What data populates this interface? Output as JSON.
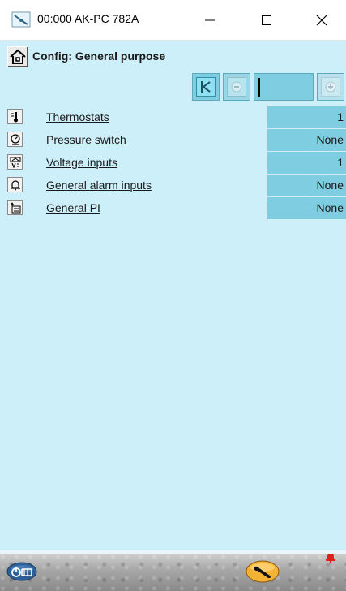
{
  "window": {
    "title": "00:000 AK-PC 782A",
    "icon": "app-plug-icon",
    "controls": [
      "minimize-icon",
      "maximize-icon",
      "close-icon"
    ]
  },
  "header": {
    "home_icon": "home-icon",
    "title": "Config: General purpose"
  },
  "navigation": {
    "buttons": [
      "first-page-icon",
      "previous-page-icon",
      "next-page-icon"
    ],
    "field_value": ""
  },
  "items": [
    {
      "label": "Thermostats",
      "value": "1",
      "icon": "thermometer-icon"
    },
    {
      "label": "Pressure switch",
      "value": "None",
      "icon": "pressure-gauge-icon"
    },
    {
      "label": "Voltage inputs",
      "value": "1",
      "icon": "voltage-meter-icon"
    },
    {
      "label": "General alarm inputs",
      "value": "None",
      "icon": "alarm-bell-icon"
    },
    {
      "label": "General PI",
      "value": "None",
      "icon": "pi-controller-icon"
    }
  ],
  "footer": {
    "left_icon": "device-toggle-icon",
    "right_icon": "wrench-service-icon",
    "alarm_icon": "alarm-bell-red-icon"
  },
  "colors": {
    "background": "#cdeff9",
    "value_cell": "#7ecde0",
    "alarm_red": "#e0201e"
  }
}
